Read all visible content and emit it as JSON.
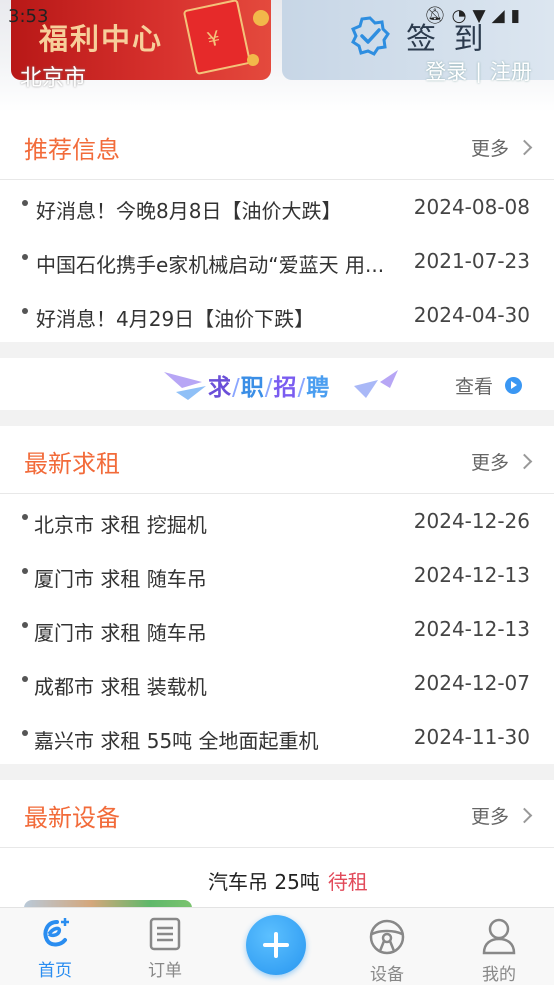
{
  "status_bar": {
    "time": "3:53"
  },
  "header": {
    "welfare_banner": "福利中心",
    "city": "北京市",
    "checkin_label": "签 到",
    "login": "登录",
    "separator": "|",
    "register": "注册"
  },
  "recommend": {
    "title": "推荐信息",
    "more": "更多",
    "items": [
      {
        "text": "好消息！今晚8月8日【油价大跌】",
        "date": "2024-08-08"
      },
      {
        "text": "中国石化携手e家机械启动“爱蓝天 用...",
        "date": "2021-07-23"
      },
      {
        "text": "好消息！4月29日【油价下跌】",
        "date": "2024-04-30"
      }
    ]
  },
  "jobs_banner": {
    "chars": [
      "求",
      "职",
      "招",
      "聘"
    ],
    "slash": "/",
    "view": "查看"
  },
  "rent": {
    "title": "最新求租",
    "more": "更多",
    "items": [
      {
        "text": "北京市 求租 挖掘机",
        "date": "2024-12-26"
      },
      {
        "text": "厦门市 求租 随车吊",
        "date": "2024-12-13"
      },
      {
        "text": "厦门市 求租 随车吊",
        "date": "2024-12-13"
      },
      {
        "text": "成都市 求租 装载机",
        "date": "2024-12-07"
      },
      {
        "text": "嘉兴市 求租 55吨 全地面起重机",
        "date": "2024-11-30"
      }
    ]
  },
  "equipment": {
    "title": "最新设备",
    "more": "更多",
    "first_item": {
      "name": "汽车吊 25吨",
      "status": "待租"
    }
  },
  "tabbar": {
    "home": "首页",
    "orders": "订单",
    "devices": "设备",
    "mine": "我的"
  },
  "colors": {
    "accent_orange": "#f26b3a",
    "primary_blue": "#2a8df0",
    "status_red": "#e24a5a"
  }
}
